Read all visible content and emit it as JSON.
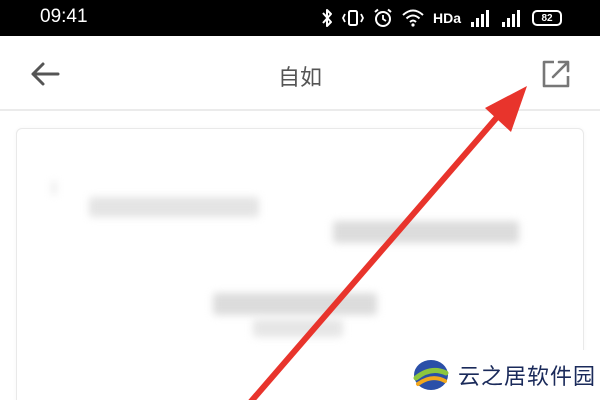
{
  "status_bar": {
    "time": "09:41",
    "network_label": "HDa",
    "battery_level": "82"
  },
  "header": {
    "back_icon": "arrow-left-icon",
    "title": "自如",
    "share_icon": "share-external-icon"
  },
  "annotation": {
    "arrow_color": "#e8342c",
    "target": "share-button"
  },
  "watermark": {
    "text": "云之居软件园"
  }
}
